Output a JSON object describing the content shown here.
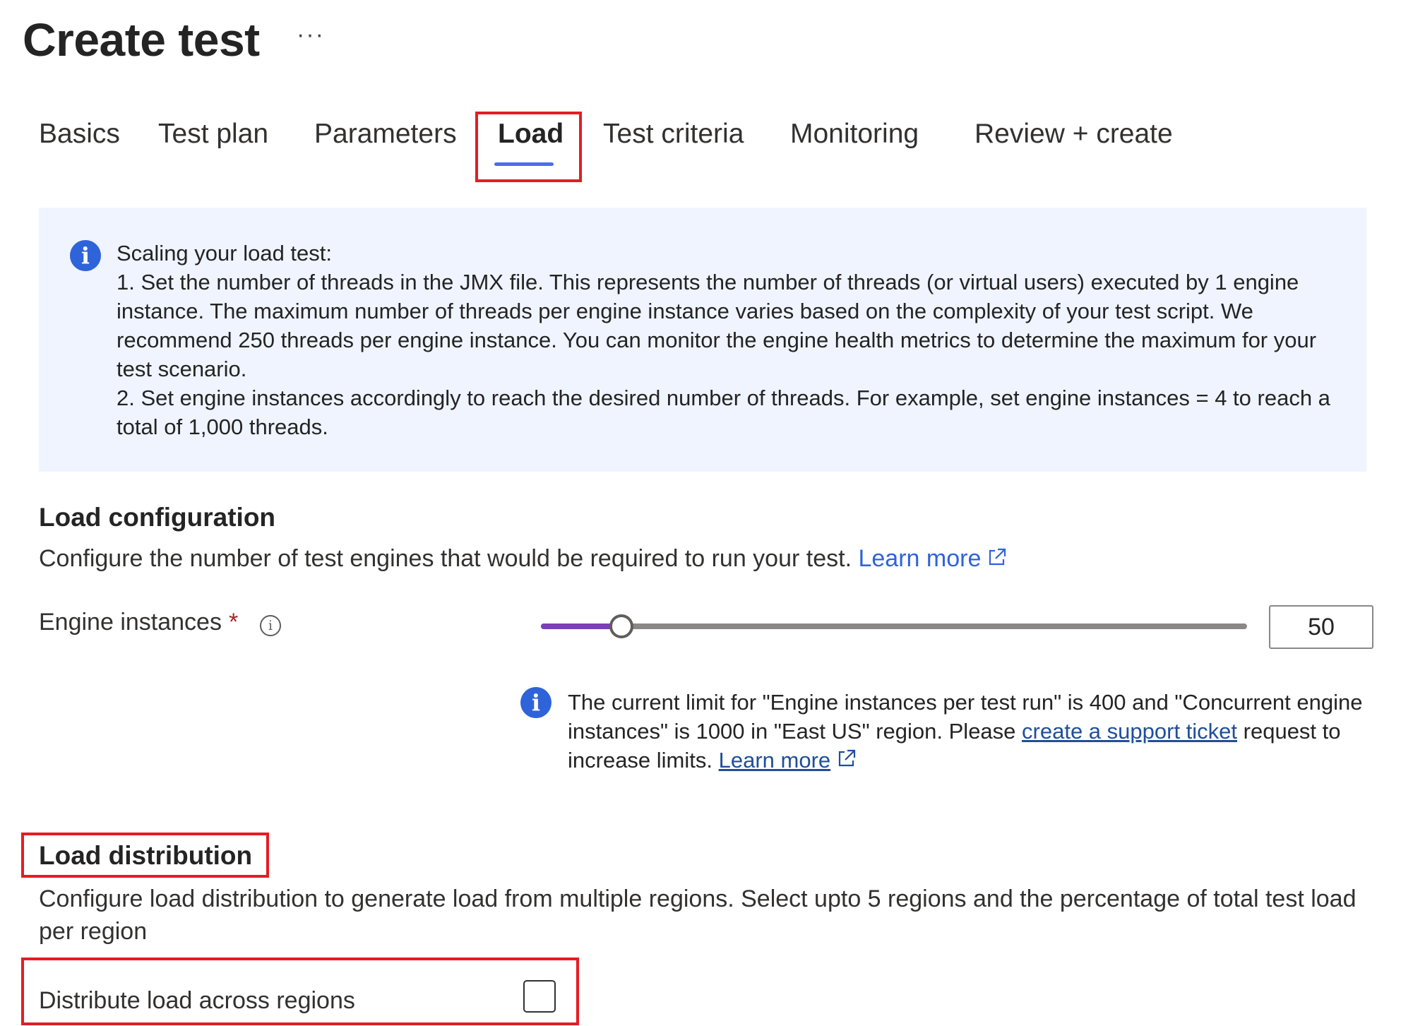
{
  "page": {
    "title": "Create test",
    "more": "···"
  },
  "tabs": [
    {
      "label": "Basics"
    },
    {
      "label": "Test plan"
    },
    {
      "label": "Parameters"
    },
    {
      "label": "Load"
    },
    {
      "label": "Test criteria"
    },
    {
      "label": "Monitoring"
    },
    {
      "label": "Review + create"
    }
  ],
  "active_tab": "Load",
  "scaling_info": {
    "heading": "Scaling your load test:",
    "step1": "1. Set the number of threads in the JMX file. This represents the number of threads (or virtual users) executed by 1 engine instance. The maximum number of threads per engine instance varies based on the complexity of your test script. We recommend 250 threads per engine instance. You can monitor the engine health metrics to determine the maximum for your test scenario.",
    "step2": "2. Set engine instances accordingly to reach the desired number of threads. For example, set engine instances = 4 to reach a total of 1,000 threads."
  },
  "load_configuration": {
    "heading": "Load configuration",
    "description": "Configure the number of test engines that would be required to run your test.",
    "learn_more": "Learn more"
  },
  "engine_instances": {
    "label": "Engine instances",
    "required_marker": "*",
    "info_glyph": "i",
    "value": "50",
    "slider_fraction": 0.1
  },
  "limit_info": {
    "text_before": "The current limit for \"Engine instances per test run\" is 400 and \"Concurrent engine instances\" is 1000 in \"East US\" region. Please ",
    "support_link": "create a support ticket",
    "text_after": " request to increase limits. ",
    "learn_more": "Learn more"
  },
  "load_distribution": {
    "heading": "Load distribution",
    "description": "Configure load distribution to generate load from multiple regions. Select upto 5 regions and the percentage of total test load per region",
    "checkbox_label": "Distribute load across regions",
    "checked": false
  },
  "colors": {
    "accent": "#4f6bed",
    "link": "#2f63d9",
    "highlight": "#e51c23",
    "info_bg": "#eff4ff",
    "slider_fill": "#7b3fb8"
  }
}
